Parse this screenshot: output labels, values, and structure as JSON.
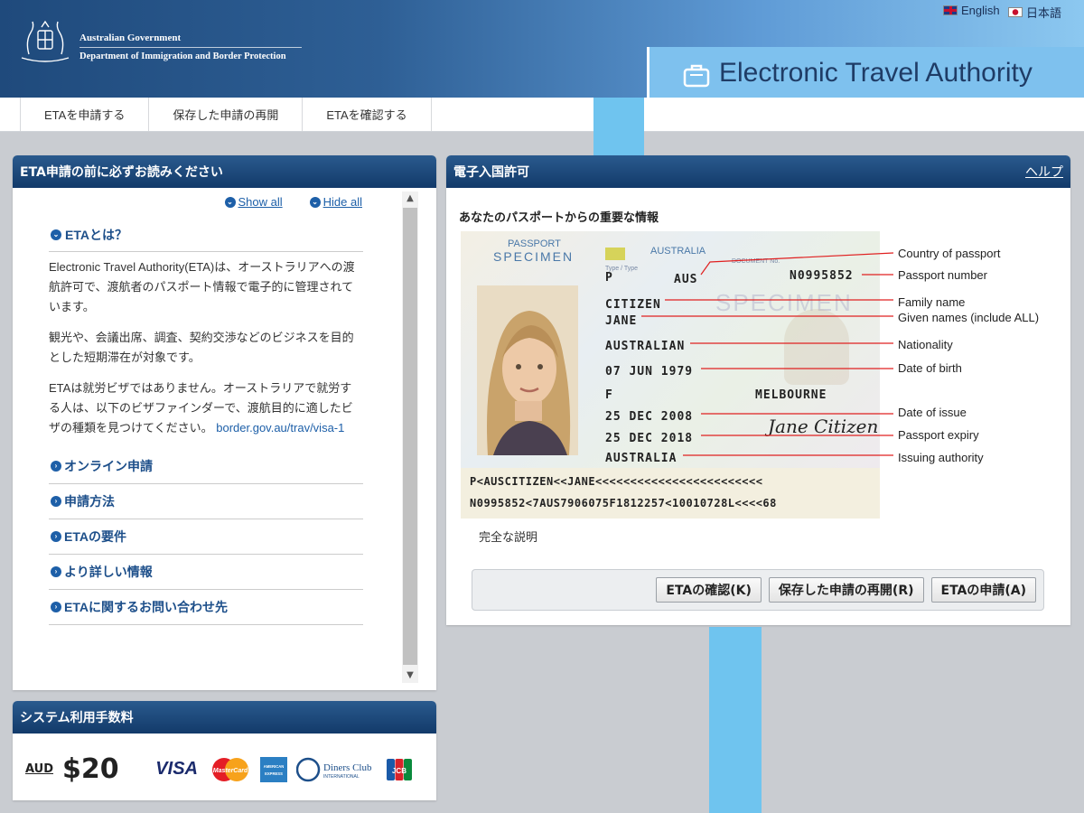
{
  "header": {
    "gov_line1": "Australian Government",
    "gov_line2": "Department of Immigration and Border Protection",
    "app_title": "Electronic Travel Authority",
    "lang_en": "English",
    "lang_ja": "日本語"
  },
  "nav": {
    "items": [
      "ETAを申請する",
      "保存した申請の再開",
      "ETAを確認する"
    ]
  },
  "left_panel": {
    "title": "ETA申請の前に必ずお読みください",
    "show_all": "Show all",
    "hide_all": "Hide all",
    "open_section": {
      "title": "ETAとは？",
      "p1": "Electronic Travel Authority(ETA)は、オーストラリアへの渡航許可で、渡航者のパスポート情報で電子的に管理されています。",
      "p2": "観光や、会議出席、調査、契約交渉などのビジネスを目的とした短期滞在が対象です。",
      "p3": "ETAは就労ビザではありません。オーストラリアで就労する人は、以下のビザファインダーで、渡航目的に適したビザの種類を見つけてください。",
      "p3_link": "border.gov.au/trav/visa-1"
    },
    "sections": [
      "オンライン申請",
      "申請方法",
      "ETAの要件",
      "より詳しい情報",
      "ETAに関するお問い合わせ先"
    ]
  },
  "fee_panel": {
    "title": "システム利用手数料",
    "currency": "AUD",
    "amount": "$20",
    "cards": [
      "VISA",
      "MasterCard",
      "AMERICAN EXPRESS",
      "Diners Club INTERNATIONAL",
      "JCB"
    ]
  },
  "right_panel": {
    "title": "電子入国許可",
    "help": "ヘルプ",
    "caption": "あなたのパスポートからの重要な情報",
    "passport": {
      "passport_label": "PASSPORT",
      "specimen": "SPECIMEN",
      "country_header": "AUSTRALIA",
      "type": "P",
      "country_code": "AUS",
      "doc_no_label": "DOCUMENT No.",
      "doc_no": "N0995852",
      "surname": "CITIZEN",
      "given": "JANE",
      "nationality": "AUSTRALIAN",
      "dob": "07 JUN 1979",
      "sex": "F",
      "birthplace": "MELBOURNE",
      "issue": "25 DEC 2008",
      "expiry": "25 DEC 2018",
      "authority": "AUSTRALIA",
      "signature": "Jane Citizen",
      "mrz1": "P<AUSCITIZEN<<JANE<<<<<<<<<<<<<<<<<<<<<<<<",
      "mrz2": "N0995852<7AUS7906075F1812257<10010728L<<<<68"
    },
    "callouts": [
      "Country of passport",
      "Passport number",
      "Family name",
      "Given names (include ALL)",
      "Nationality",
      "Date of birth",
      "Date of issue",
      "Passport expiry",
      "Issuing authority"
    ],
    "full_description": "完全な説明",
    "buttons": {
      "check": "ETAの確認(K)",
      "resume": "保存した申請の再開(R)",
      "apply": "ETAの申請(A)"
    }
  },
  "colors": {
    "header_dark": "#1f4a7c",
    "panel_head": "#123a6a",
    "accent_blue": "#6fc4ef",
    "link": "#1d5fa8",
    "callout_line": "#e02020"
  }
}
